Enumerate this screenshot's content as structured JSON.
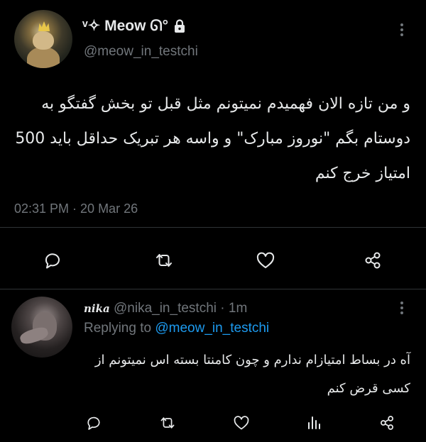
{
  "main_tweet": {
    "display_name": "ᵛ✧ Meow ᘏ°",
    "handle": "@meow_in_testchi",
    "text": "و من تازه الان فهمیدم نمیتونم مثل قبل تو بخش گفتگو به دوستام بگم \"نوروز مبارک\" و واسه هر تبریک حداقل باید 500 امتیاز خرج کنم",
    "timestamp": "02:31 PM · 20 Mar 26",
    "icons": [
      "lock-icon",
      "more-icon",
      "reply-icon",
      "retweet-icon",
      "like-icon",
      "share-icon"
    ]
  },
  "reply": {
    "display_name": "nika",
    "handle": "@nika_in_testchi",
    "time": "· 1m",
    "replying_label": "Replying to",
    "replying_handle": "@meow_in_testchi",
    "text": "آه در بساط امتیازام ندارم و چون کامنتا بسته اس نمیتونم از کسی قرض کنم",
    "icons": [
      "more-icon",
      "reply-icon",
      "retweet-icon",
      "like-icon",
      "stats-icon",
      "share-icon"
    ]
  },
  "colors": {
    "background": "#000000",
    "primary_text": "#e7e9ea",
    "secondary_text": "#71767b",
    "link": "#1d9bf0",
    "divider": "#2f3336"
  }
}
